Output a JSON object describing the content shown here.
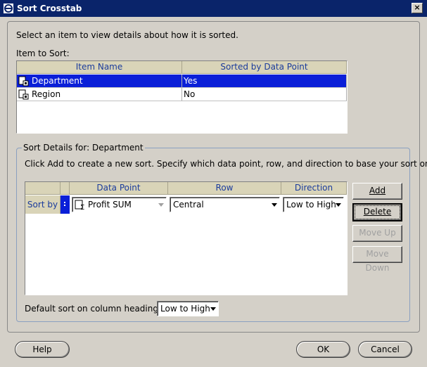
{
  "window": {
    "title": "Sort Crosstab",
    "close_glyph": "×"
  },
  "intro": "Select an item to view details about how it is sorted.",
  "items_label": "Item to Sort:",
  "items_table": {
    "columns": [
      "Item Name",
      "Sorted by Data Point"
    ],
    "rows": [
      {
        "name": "Department",
        "sorted": "Yes",
        "selected": true
      },
      {
        "name": "Region",
        "sorted": "No",
        "selected": false
      }
    ]
  },
  "details": {
    "legend": "Sort Details for: Department",
    "instructions": "Click Add to create a new sort. Specify which data point, row, and direction to base your sort on.",
    "columns": [
      "Data Point",
      "Row",
      "Direction"
    ],
    "row_label": "Sort by",
    "data_point": "Profit SUM",
    "row_value": "Central",
    "direction": "Low to High",
    "buttons": {
      "add": "Add",
      "delete": "Delete",
      "move_up": "Move Up",
      "move_down": "Move Down"
    },
    "default_sort_label": "Default sort on column headings:",
    "default_sort_value": "Low to High"
  },
  "footer": {
    "help": "Help",
    "ok": "OK",
    "cancel": "Cancel"
  },
  "colors": {
    "titlebar": "#0a246a",
    "selection": "#0a1fd8",
    "header_bg": "#d9d4b8",
    "header_text": "#1a3b9c"
  }
}
